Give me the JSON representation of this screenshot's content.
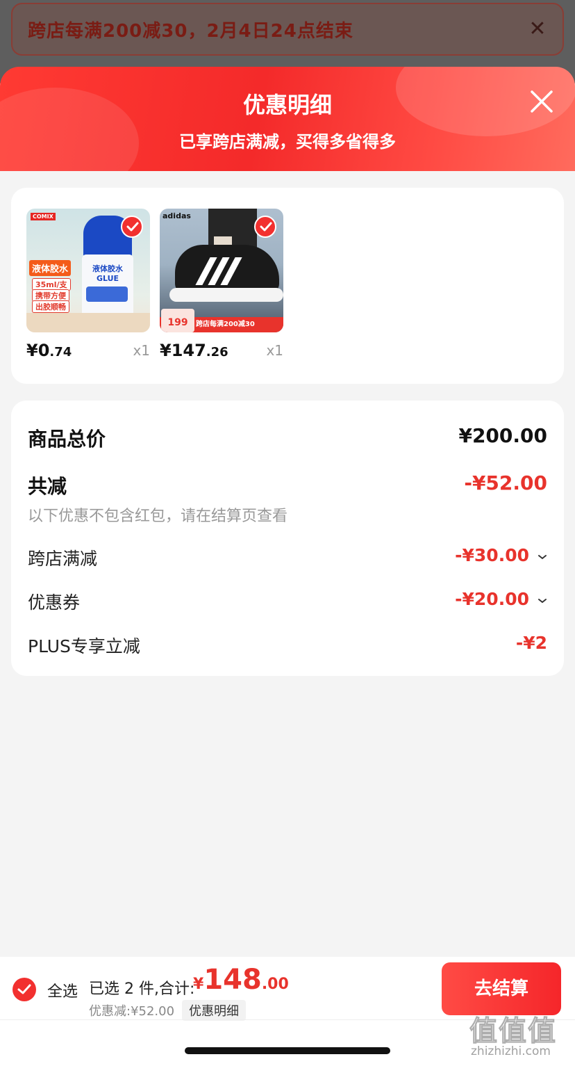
{
  "banner": {
    "text": "跨店每满200减30，2月4日24点结束",
    "close_icon": "close-icon"
  },
  "header": {
    "title": "优惠明细",
    "subtitle": "已享跨店满减，买得多省得多"
  },
  "products": [
    {
      "price_main": "¥0",
      "price_decimal": ".74",
      "quantity": "x1",
      "image_texts": [
        "液体胶水",
        "35ml/支",
        "携带方便",
        "出胶顺畅",
        "液体胶水",
        "GLUE"
      ],
      "selected": true
    },
    {
      "price_main": "¥147",
      "price_decimal": ".26",
      "quantity": "x1",
      "image_texts": [
        "adidas",
        "199",
        "跨店每满200减30"
      ],
      "selected": true
    }
  ],
  "summary": {
    "total_label": "商品总价",
    "total_value": "¥200.00",
    "discount_label": "共减",
    "discount_value": "-¥52.00",
    "note": "以下优惠不包含红包，请在结算页查看",
    "items": [
      {
        "label": "跨店满减",
        "value": "-¥30.00",
        "expandable": true
      },
      {
        "label": "优惠券",
        "value": "-¥20.00",
        "expandable": true
      },
      {
        "label": "PLUS专享立减",
        "value": "-¥2",
        "expandable": false
      }
    ]
  },
  "bottom_bar": {
    "select_all_label": "全选",
    "selected_text": "已选 2 件,合计:",
    "total_currency": "¥",
    "total_integer": "148",
    "total_decimal": ".00",
    "discount_line": "优惠减:¥52.00",
    "detail_label": "优惠明细",
    "checkout_label": "去结算"
  },
  "watermark": {
    "glyphs": "值值值",
    "url": "zhizhizhi.com"
  },
  "colors": {
    "accent_red": "#e8332c",
    "header_red": "#f42a2a"
  }
}
